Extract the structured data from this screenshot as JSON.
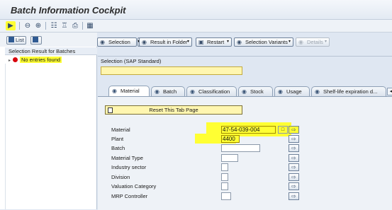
{
  "window": {
    "title": "Batch Information Cockpit"
  },
  "toolbar": {
    "icons": [
      "execute-icon",
      "zoom-out-icon",
      "zoom-in-icon",
      "flow-icon",
      "hierarchy-icon",
      "print-icon",
      "layout-icon"
    ]
  },
  "left_panel": {
    "list_button": "List",
    "result_header": "Selection Result for Batches",
    "no_entries": "No entries found"
  },
  "right_toolbar": {
    "selection": "Selection",
    "result_in_folder": "Result in Folder",
    "restart": "Restart",
    "selection_variants": "Selection Variants",
    "details": "Details"
  },
  "selection_panel": {
    "header": "Selection (SAP Standard)",
    "tabs": [
      "Material",
      "Batch",
      "Classification",
      "Stock",
      "Usage",
      "Shelf-life expiration d..."
    ],
    "active_tab": "Material",
    "reset_button": "Reset This Tab Page",
    "fields": [
      {
        "label": "Material",
        "value": "47-54-039-004"
      },
      {
        "label": "Plant",
        "value": "4400"
      },
      {
        "label": "Batch",
        "value": ""
      },
      {
        "label": "Material Type",
        "value": ""
      },
      {
        "label": "Industry sector",
        "value": ""
      },
      {
        "label": "Division",
        "value": ""
      },
      {
        "label": "Valuation Category",
        "value": ""
      },
      {
        "label": "MRP Controller",
        "value": ""
      }
    ]
  },
  "colors": {
    "highlight": "#ffff33",
    "background": "#dfe7f2",
    "error": "#d8000c"
  }
}
